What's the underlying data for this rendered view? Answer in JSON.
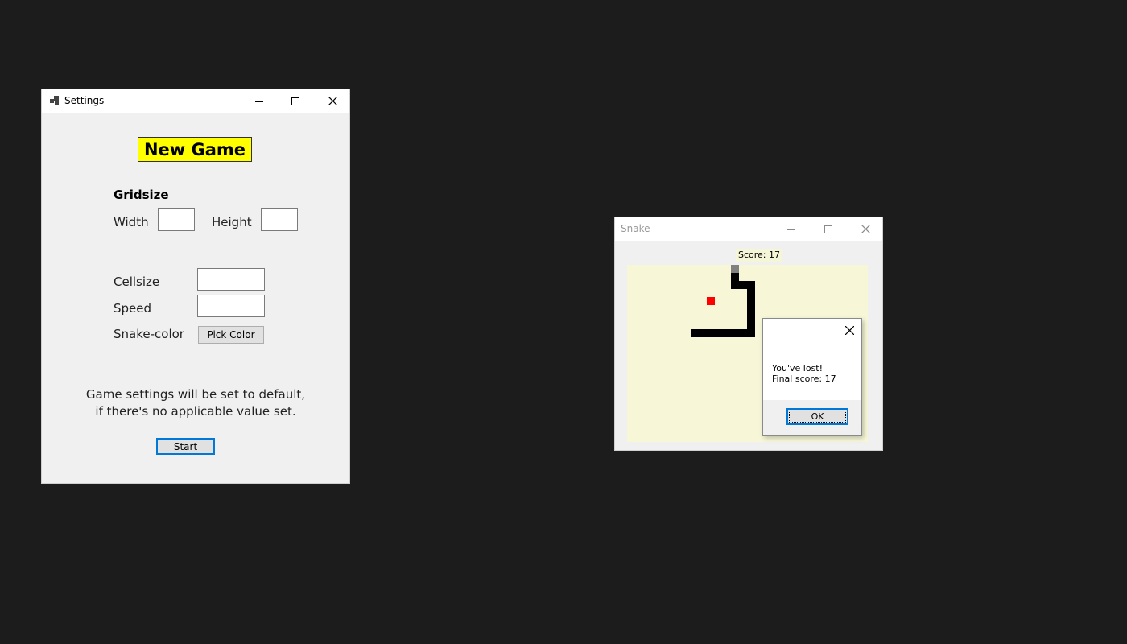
{
  "settings_window": {
    "title": "Settings",
    "new_game_label": "New Game",
    "gridsize_heading": "Gridsize",
    "width_label": "Width",
    "width_value": "",
    "height_label": "Height",
    "height_value": "",
    "cellsize_label": "Cellsize",
    "cellsize_value": "",
    "speed_label": "Speed",
    "speed_value": "",
    "snake_color_label": "Snake-color",
    "pick_color_label": "Pick Color",
    "note_line1": "Game settings will be set to default,",
    "note_line2": "if there's no applicable value set.",
    "start_label": "Start"
  },
  "snake_window": {
    "title": "Snake",
    "score_text": "Score: 17",
    "colors": {
      "board": "#f7f7d8",
      "snake_body": "#000000",
      "snake_head": "#808080",
      "food": "#ff0000"
    }
  },
  "message_box": {
    "line1": "You've lost!",
    "line2": "Final score: 17",
    "ok_label": "OK"
  }
}
